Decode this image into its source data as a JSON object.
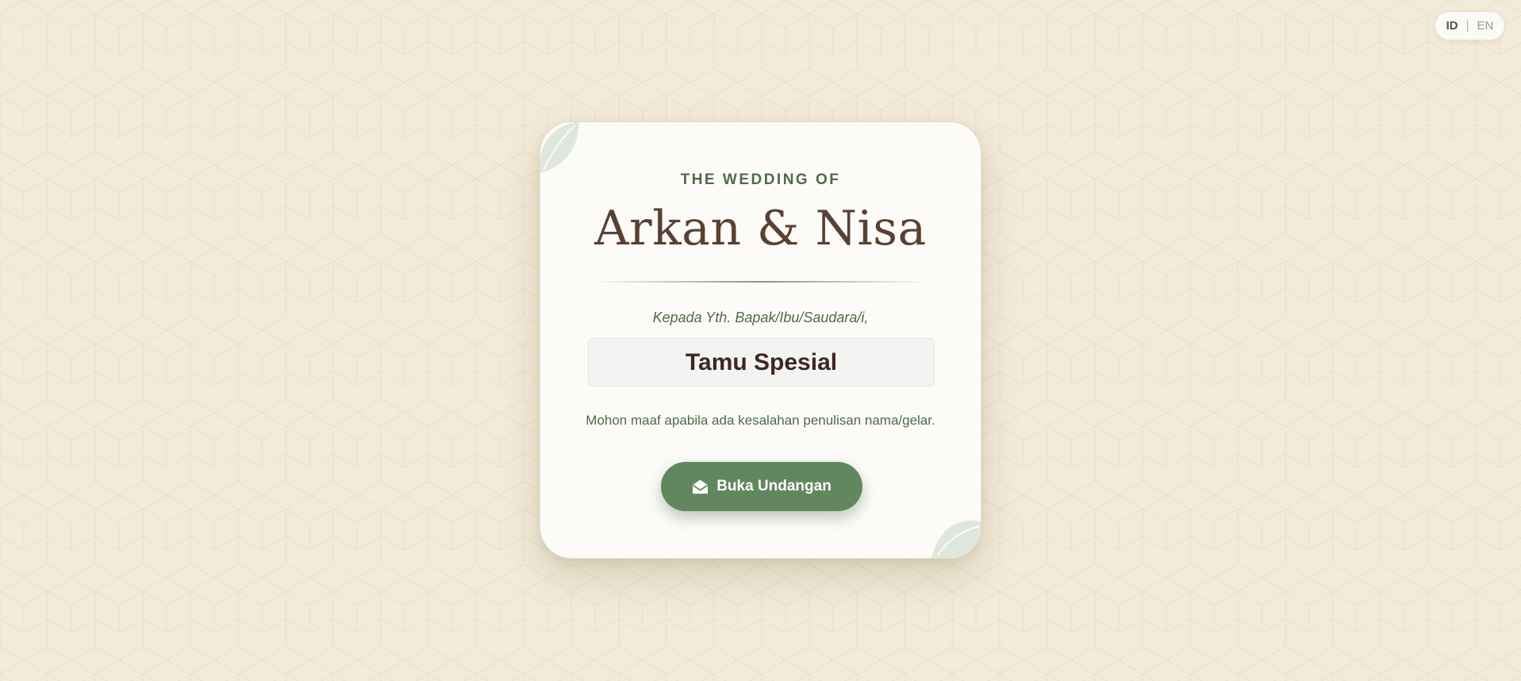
{
  "language_switch": {
    "id_label": "ID",
    "separator": "|",
    "en_label": "EN",
    "active": "ID"
  },
  "card": {
    "subtitle": "THE WEDDING OF",
    "couple_names": "Arkan & Nisa",
    "greeting": "Kepada Yth. Bapak/Ibu/Saudara/i,",
    "guest_name": "Tamu Spesial",
    "apology": "Mohon maaf apabila ada kesalahan penulisan nama/gelar.",
    "open_button": {
      "label": "Buka Undangan",
      "icon": "envelope-open-icon"
    },
    "decorations": [
      "leaf-icon",
      "leaf-icon"
    ]
  },
  "colors": {
    "background": "#f3ebd9",
    "card": "#fcfbf8",
    "accent_green": "#62875e",
    "heading_brown": "#5a4034",
    "guest_text": "#3d2626"
  }
}
